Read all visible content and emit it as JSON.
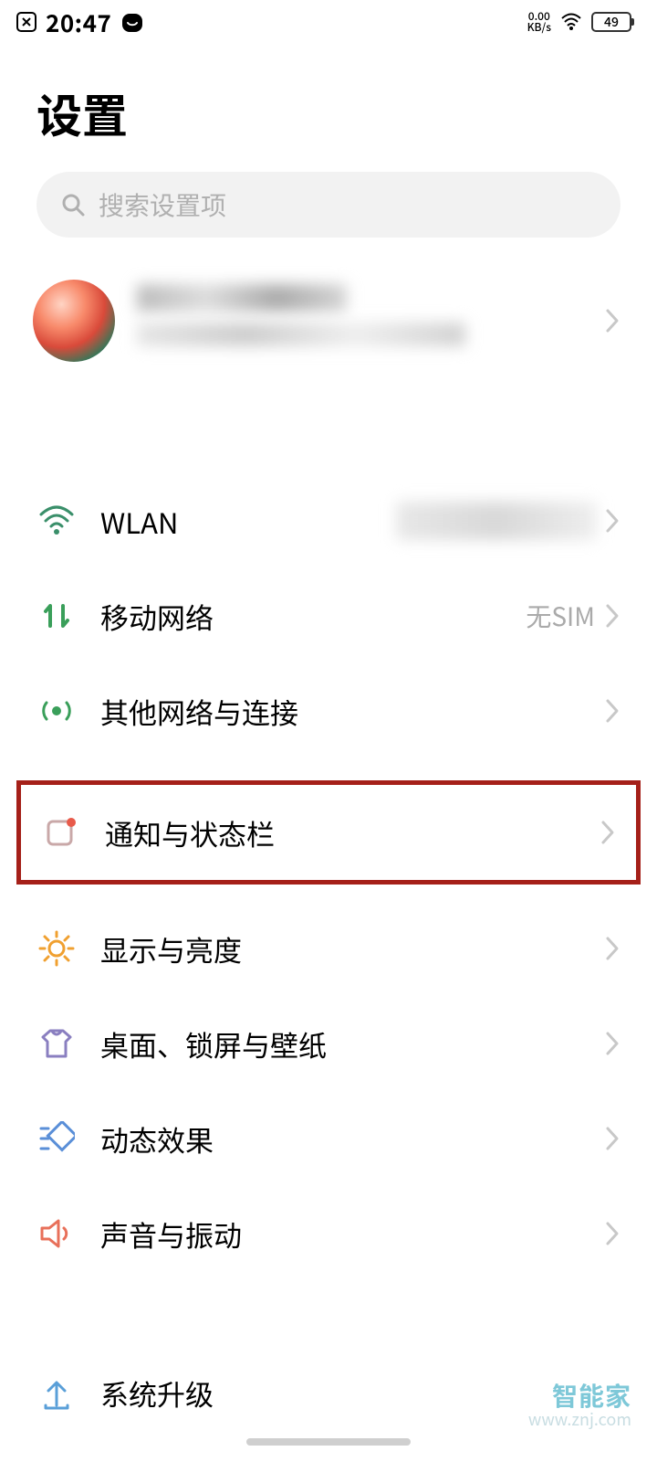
{
  "status": {
    "time": "20:47",
    "net_speed_top": "0.00",
    "net_speed_bottom": "KB/s",
    "battery": "49"
  },
  "header": {
    "title": "设置"
  },
  "search": {
    "placeholder": "搜索设置项"
  },
  "items": {
    "wlan": {
      "label": "WLAN",
      "value": ""
    },
    "mobile": {
      "label": "移动网络",
      "value": "无SIM"
    },
    "other_network": {
      "label": "其他网络与连接"
    },
    "notification": {
      "label": "通知与状态栏"
    },
    "display": {
      "label": "显示与亮度"
    },
    "home": {
      "label": "桌面、锁屏与壁纸"
    },
    "effects": {
      "label": "动态效果"
    },
    "sound": {
      "label": "声音与振动"
    },
    "system_update": {
      "label": "系统升级"
    }
  },
  "watermark": {
    "line1": "智能家",
    "line2": "www.znj.com"
  }
}
